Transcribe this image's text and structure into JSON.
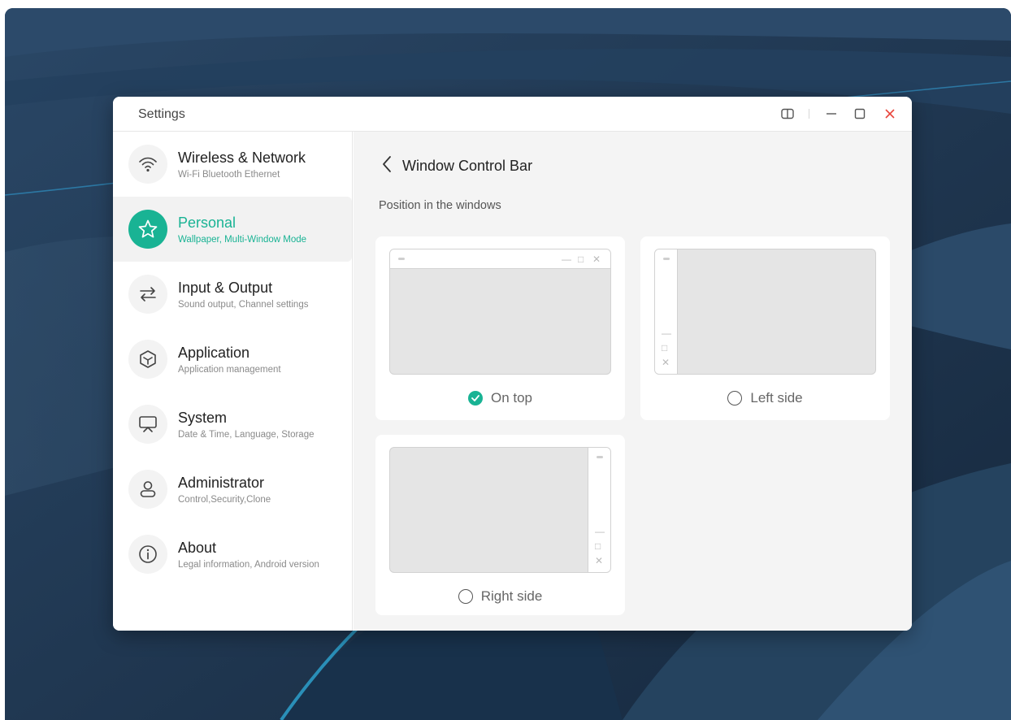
{
  "window": {
    "title": "Settings",
    "controls": [
      "split-view-icon",
      "minimize-icon",
      "maximize-icon",
      "close-icon"
    ]
  },
  "sidebar": {
    "items": [
      {
        "title": "Wireless & Network",
        "subtitle": "Wi-Fi Bluetooth Ethernet",
        "icon": "wifi-icon",
        "active": false
      },
      {
        "title": "Personal",
        "subtitle": "Wallpaper, Multi-Window Mode",
        "icon": "star-icon",
        "active": true
      },
      {
        "title": "Input & Output",
        "subtitle": "Sound output, Channel settings",
        "icon": "swap-arrows-icon",
        "active": false
      },
      {
        "title": "Application",
        "subtitle": "Application management",
        "icon": "cube-icon",
        "active": false
      },
      {
        "title": "System",
        "subtitle": "Date & Time, Language, Storage",
        "icon": "presentation-screen-icon",
        "active": false
      },
      {
        "title": "Administrator",
        "subtitle": "Control,Security,Clone",
        "icon": "person-icon",
        "active": false
      },
      {
        "title": "About",
        "subtitle": "Legal information, Android version",
        "icon": "info-icon",
        "active": false
      }
    ]
  },
  "content": {
    "page_title": "Window Control Bar",
    "section_label": "Position in the windows",
    "options": [
      {
        "label": "On top",
        "selected": true
      },
      {
        "label": "Left side",
        "selected": false
      },
      {
        "label": "Right side",
        "selected": false
      }
    ]
  },
  "colors": {
    "accent": "#19b394",
    "close": "#e8453c",
    "wallpaper": "#1e3550"
  }
}
